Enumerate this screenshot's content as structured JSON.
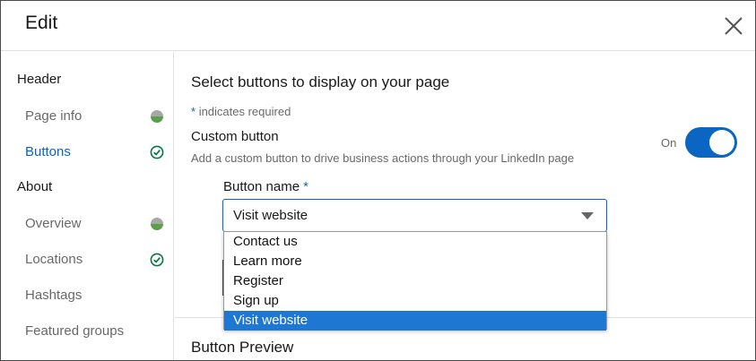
{
  "header": {
    "title": "Edit"
  },
  "sidebar": {
    "groups": [
      {
        "label": "Header"
      },
      {
        "label": "About"
      }
    ],
    "items": [
      {
        "label": "Page info",
        "icon": "half-filled-circle-icon"
      },
      {
        "label": "Buttons",
        "icon": "check-circle-icon",
        "active": true
      },
      {
        "label": "Overview",
        "icon": "half-filled-circle-icon"
      },
      {
        "label": "Locations",
        "icon": "check-circle-icon"
      },
      {
        "label": "Hashtags"
      },
      {
        "label": "Featured groups"
      }
    ]
  },
  "main": {
    "section_title": "Select buttons to display on your page",
    "required_star": "*",
    "required_note": "indicates required",
    "custom_button": {
      "label": "Custom button",
      "description": "Add a custom button to drive business actions through your LinkedIn page",
      "toggle_state_text": "On"
    },
    "button_name": {
      "label": "Button name",
      "required_star": "*",
      "selected": "Visit website",
      "options": [
        "Contact us",
        "Learn more",
        "Register",
        "Sign up",
        "Visit website"
      ]
    },
    "preview_title": "Button Preview"
  },
  "colors": {
    "accent": "#0a66c2",
    "selected_option": "#1e77d3",
    "complete_green": "#057642",
    "partial_gray": "#a7a7a7",
    "partial_green": "#5aa04b"
  }
}
